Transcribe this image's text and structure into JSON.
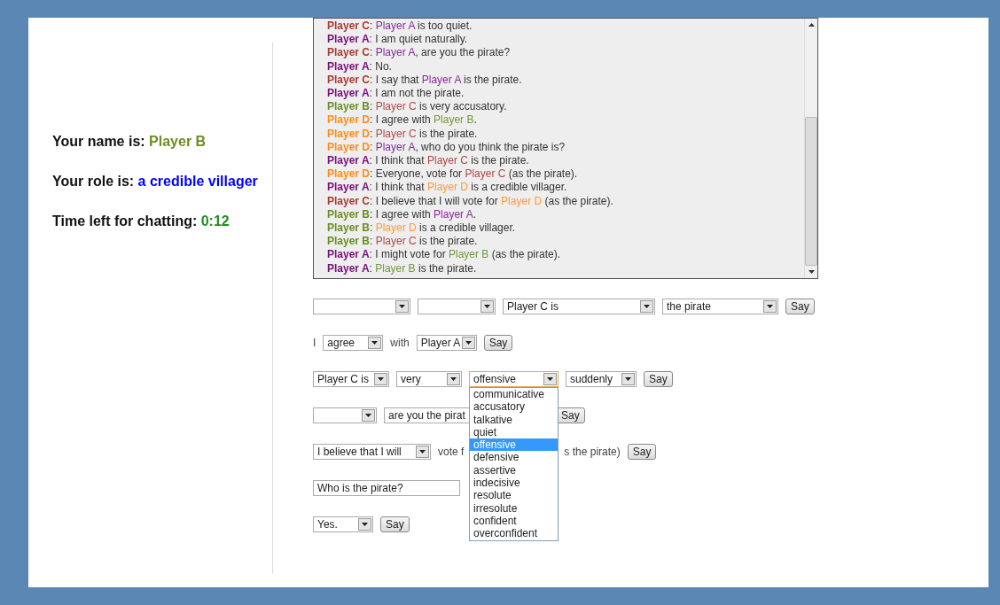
{
  "status": [
    {
      "label": "Your name is:",
      "value": "Player B",
      "color": "#6b8e23"
    },
    {
      "label": "Your role is:",
      "value": "a credible villager",
      "color": "#0000ff"
    },
    {
      "label": "Time left for chatting:",
      "value": "0:12",
      "color": "#238b23"
    }
  ],
  "chat": [
    {
      "speaker": "Player C",
      "color": "#a83a32",
      "parts": [
        {
          "text": ": "
        },
        {
          "text": "Player A",
          "color": "#8b2a9b"
        },
        {
          "text": " is too quiet."
        }
      ]
    },
    {
      "speaker": "Player A",
      "color": "#7a0f7a",
      "parts": [
        {
          "text": ": I am quiet naturally."
        }
      ]
    },
    {
      "speaker": "Player C",
      "color": "#a83a32",
      "parts": [
        {
          "text": ": "
        },
        {
          "text": "Player A",
          "color": "#8b2a9b"
        },
        {
          "text": ", are you the pirate?"
        }
      ]
    },
    {
      "speaker": "Player A",
      "color": "#7a0f7a",
      "parts": [
        {
          "text": ": No."
        }
      ]
    },
    {
      "speaker": "Player C",
      "color": "#a83a32",
      "parts": [
        {
          "text": ": I say that "
        },
        {
          "text": "Player A",
          "color": "#8b2a9b"
        },
        {
          "text": " is the pirate."
        }
      ]
    },
    {
      "speaker": "Player A",
      "color": "#7a0f7a",
      "parts": [
        {
          "text": ": I am not the pirate."
        }
      ]
    },
    {
      "speaker": "Player B",
      "color": "#6b8e23",
      "parts": [
        {
          "text": ": "
        },
        {
          "text": "Player C",
          "color": "#b04848"
        },
        {
          "text": " is very accusatory."
        }
      ]
    },
    {
      "speaker": "Player D",
      "color": "#ff8c1a",
      "parts": [
        {
          "text": ": I agree with "
        },
        {
          "text": "Player B",
          "color": "#6f9a3a"
        },
        {
          "text": "."
        }
      ]
    },
    {
      "speaker": "Player D",
      "color": "#ff8c1a",
      "parts": [
        {
          "text": ": "
        },
        {
          "text": "Player C",
          "color": "#b04848"
        },
        {
          "text": " is the pirate."
        }
      ]
    },
    {
      "speaker": "Player D",
      "color": "#ff8c1a",
      "parts": [
        {
          "text": ": "
        },
        {
          "text": "Player A",
          "color": "#8b2a9b"
        },
        {
          "text": ", who do you think the pirate is?"
        }
      ]
    },
    {
      "speaker": "Player A",
      "color": "#7a0f7a",
      "parts": [
        {
          "text": ": I think that "
        },
        {
          "text": "Player C",
          "color": "#b04848"
        },
        {
          "text": " is the pirate."
        }
      ]
    },
    {
      "speaker": "Player D",
      "color": "#ff8c1a",
      "parts": [
        {
          "text": ": Everyone, vote for "
        },
        {
          "text": "Player C",
          "color": "#b04848"
        },
        {
          "text": " (as the pirate)."
        }
      ]
    },
    {
      "speaker": "Player A",
      "color": "#7a0f7a",
      "parts": [
        {
          "text": ": I think that "
        },
        {
          "text": "Player D",
          "color": "#ff9a3a"
        },
        {
          "text": " is a credible villager."
        }
      ]
    },
    {
      "speaker": "Player C",
      "color": "#a83a32",
      "parts": [
        {
          "text": ": I believe that I will vote for "
        },
        {
          "text": "Player D",
          "color": "#ff9a3a"
        },
        {
          "text": " (as the pirate)."
        }
      ]
    },
    {
      "speaker": "Player B",
      "color": "#6b8e23",
      "parts": [
        {
          "text": ": I agree with "
        },
        {
          "text": "Player A",
          "color": "#8b2a9b"
        },
        {
          "text": "."
        }
      ]
    },
    {
      "speaker": "Player B",
      "color": "#6b8e23",
      "parts": [
        {
          "text": ": "
        },
        {
          "text": "Player D",
          "color": "#ff9a3a"
        },
        {
          "text": " is a credible villager."
        }
      ]
    },
    {
      "speaker": "Player B",
      "color": "#6b8e23",
      "parts": [
        {
          "text": ": "
        },
        {
          "text": "Player C",
          "color": "#b04848"
        },
        {
          "text": " is the pirate."
        }
      ]
    },
    {
      "speaker": "Player A",
      "color": "#7a0f7a",
      "parts": [
        {
          "text": ": I might vote for "
        },
        {
          "text": "Player B",
          "color": "#6f9a3a"
        },
        {
          "text": " (as the pirate)."
        }
      ]
    },
    {
      "speaker": "Player A",
      "color": "#7a0f7a",
      "parts": [
        {
          "text": ": "
        },
        {
          "text": "Player B",
          "color": "#6f9a3a"
        },
        {
          "text": " is the pirate."
        }
      ]
    }
  ],
  "rows": [
    {
      "items": [
        {
          "kind": "select"
        },
        {
          "kind": "select"
        },
        {
          "kind": "select",
          "value": "Player C is"
        },
        {
          "kind": "select",
          "value": "the pirate"
        },
        {
          "kind": "button",
          "label": "Say"
        }
      ]
    },
    {
      "items": [
        {
          "kind": "text",
          "text": "I"
        },
        {
          "kind": "select",
          "value": "agree"
        },
        {
          "kind": "text",
          "text": "with"
        },
        {
          "kind": "select",
          "value": "Player A"
        },
        {
          "kind": "button",
          "label": "Say"
        }
      ]
    },
    {
      "items": [
        {
          "kind": "select",
          "value": "Player C is"
        },
        {
          "kind": "select",
          "value": "very"
        },
        {
          "kind": "select",
          "value": "offensive",
          "open": true,
          "options": [
            {
              "label": "communicative",
              "selected": false
            },
            {
              "label": "accusatory",
              "selected": false
            },
            {
              "label": "talkative",
              "selected": false
            },
            {
              "label": "quiet",
              "selected": false
            },
            {
              "label": "offensive",
              "selected": true
            },
            {
              "label": "defensive",
              "selected": false
            },
            {
              "label": "assertive",
              "selected": false
            },
            {
              "label": "indecisive",
              "selected": false
            },
            {
              "label": "resolute",
              "selected": false
            },
            {
              "label": "irresolute",
              "selected": false
            },
            {
              "label": "confident",
              "selected": false
            },
            {
              "label": "overconfident",
              "selected": false
            }
          ]
        },
        {
          "kind": "select",
          "value": "suddenly"
        },
        {
          "kind": "button",
          "label": "Say"
        }
      ]
    },
    {
      "items": [
        {
          "kind": "select"
        },
        {
          "kind": "select",
          "value": "are you the pirat"
        },
        {
          "kind": "button",
          "label": "Say"
        }
      ]
    },
    {
      "items": [
        {
          "kind": "select",
          "value": "I believe that I will"
        },
        {
          "kind": "text",
          "text": "vote f"
        },
        {
          "kind": "text",
          "text": "s the pirate)"
        },
        {
          "kind": "button",
          "label": "Say"
        }
      ]
    },
    {
      "items": [
        {
          "kind": "input",
          "value": "Who is the pirate?"
        }
      ]
    },
    {
      "items": [
        {
          "kind": "select",
          "value": "Yes."
        },
        {
          "kind": "button",
          "label": "Say"
        }
      ]
    }
  ]
}
